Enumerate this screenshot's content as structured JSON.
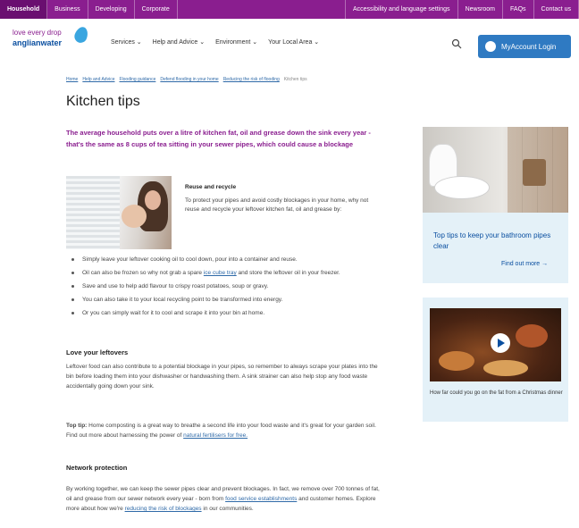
{
  "topbar": {
    "tabs": [
      "Household",
      "Business",
      "Developing",
      "Corporate"
    ],
    "links": [
      "Accessibility and language settings",
      "Newsroom",
      "FAQs",
      "Contact us"
    ]
  },
  "header": {
    "logo_line1": "love every drop",
    "logo_line2": "anglianwater",
    "nav": [
      "Services",
      "Help and Advice",
      "Environment",
      "Your Local Area"
    ],
    "login_label": "MyAccount Login"
  },
  "breadcrumb": [
    "Home",
    "Help and Advice",
    "Flooding guidance",
    "Defend flooding in your home",
    "Reducing the risk of flooding",
    "Kitchen tips"
  ],
  "page": {
    "title": "Kitchen tips",
    "intro": "The average household puts over a litre of kitchen fat, oil and grease down the sink every year - that's the same as 8 cups of tea sitting in your sewer pipes, which could cause a blockage",
    "reuse_heading": "Reuse and recycle",
    "reuse_text": "To protect your pipes and avoid costly blockages in your home, why not reuse and recycle your leftover kitchen fat, oil and grease by:",
    "bullets": {
      "b1": "Simply leave your leftover cooking oil to cool down, pour into a container and reuse.",
      "b2_pre": "Oil can also be frozen so why not grab a spare ",
      "b2_link": "ice cube tray",
      "b2_post": " and store the leftover oil in your freezer.",
      "b3": "Save and use to help add flavour to crispy roast potatoes, soup or gravy.",
      "b4": "You can also take it to your local recycling point to be transformed into energy.",
      "b5": "Or you can simply wait for it to cool and scrape it into your bin at home."
    },
    "leftovers_heading": "Love your leftovers",
    "leftovers_text": "Leftover food can also contribute to a potential blockage in your pipes, so remember to always scrape your plates into the bin before loading them into your dishwasher or handwashing them. A sink strainer can also help stop any food waste accidentally going down your sink.",
    "tip_label": "Top tip:",
    "tip_text": " Home composting is a great way to breathe a second life into your food waste and it's great for your garden soil. Find out more about harnessing the power of ",
    "tip_link": "natural fertilisers for free.",
    "network_heading": "Network protection",
    "network_text": "By working together, we can keep the sewer pipes clear and prevent blockages. In fact, we remove over 700 tonnes of fat, oil and grease from our sewer network every year - born from ",
    "network_link1": "food service establishments",
    "network_mid": " and customer homes. Explore more about how we're ",
    "network_link2": "reducing the risk of blockages",
    "network_end": " in our communities."
  },
  "sidebar": {
    "card1_title": "Top tips to keep your bathroom pipes clear",
    "card1_more": "Find out more →",
    "card2_caption": "How far could you go on the fat from a Christmas dinner"
  },
  "colors": {
    "brand_purple": "#8a1e8f",
    "brand_blue": "#0a4fa0",
    "login_blue": "#2f7ac2",
    "card_bg": "#e4f1f8"
  }
}
